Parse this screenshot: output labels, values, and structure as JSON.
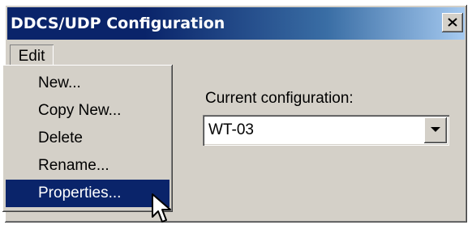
{
  "window": {
    "title": "DDCS/UDP Configuration"
  },
  "titlebar_icons": {
    "close": "close-icon"
  },
  "menubar": {
    "edit_label": "Edit"
  },
  "edit_menu": {
    "items": [
      {
        "label": "New..."
      },
      {
        "label": "Copy New..."
      },
      {
        "label": "Delete"
      },
      {
        "label": "Rename..."
      },
      {
        "label": "Properties...",
        "selected": true
      }
    ]
  },
  "config": {
    "label": "Current configuration:",
    "value": "WT-03"
  },
  "colors": {
    "title_bar": "#0a246a",
    "selection": "#0a246a",
    "face": "#d4d0c8"
  }
}
